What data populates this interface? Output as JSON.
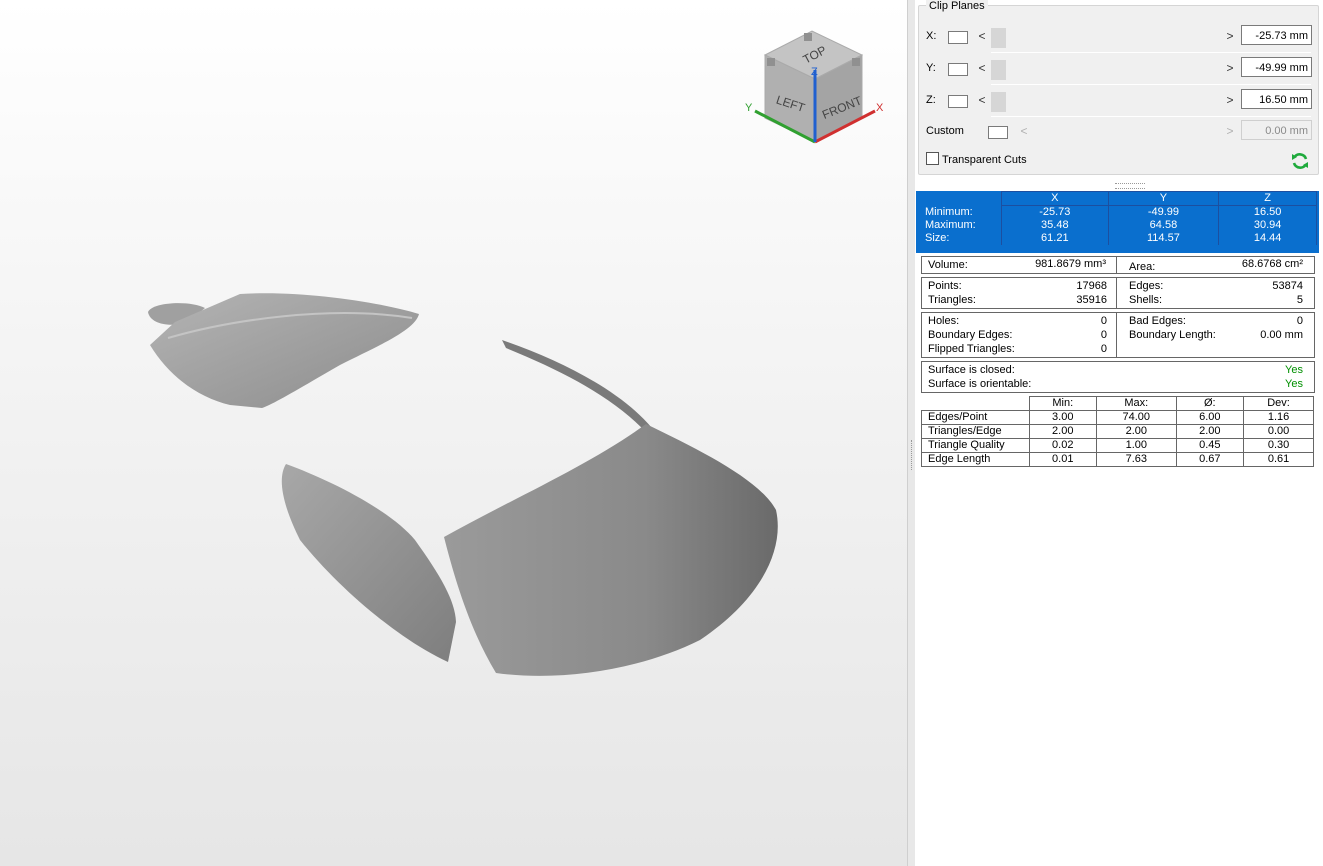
{
  "navcube": {
    "faces": {
      "top": "TOP",
      "left": "LEFT",
      "front": "FRONT"
    },
    "axes": {
      "x": "X",
      "y": "Y",
      "z": "Z"
    },
    "colors": {
      "x": "#d03030",
      "y": "#30a030",
      "z": "#2060d0"
    }
  },
  "clip_planes": {
    "title": "Clip Planes",
    "rows": [
      {
        "label": "X:",
        "value": "-25.73 mm"
      },
      {
        "label": "Y:",
        "value": "-49.99 mm"
      },
      {
        "label": "Z:",
        "value": "16.50 mm"
      },
      {
        "label": "Custom",
        "value": "0.00 mm"
      }
    ],
    "transparent_cuts_label": "Transparent Cuts",
    "arrow_left": "<",
    "arrow_right": ">"
  },
  "bounding_box": {
    "headers": [
      "X",
      "Y",
      "Z"
    ],
    "rows": [
      {
        "label": "Minimum:",
        "values": [
          "-25.73",
          "-49.99",
          "16.50"
        ]
      },
      {
        "label": "Maximum:",
        "values": [
          "35.48",
          "64.58",
          "30.94"
        ]
      },
      {
        "label": "Size:",
        "values": [
          "61.21",
          "114.57",
          "14.44"
        ]
      }
    ]
  },
  "volume": {
    "label": "Volume:",
    "value": "981.8679 mm³",
    "area_label": "Area:",
    "area_value": "68.6768 cm²"
  },
  "counts": {
    "points_label": "Points:",
    "points": "17968",
    "triangles_label": "Triangles:",
    "triangles": "35916",
    "edges_label": "Edges:",
    "edges": "53874",
    "shells_label": "Shells:",
    "shells": "5"
  },
  "errors": {
    "holes_label": "Holes:",
    "holes": "0",
    "boundary_edges_label": "Boundary Edges:",
    "boundary_edges": "0",
    "flipped_label": "Flipped Triangles:",
    "flipped": "0",
    "bad_edges_label": "Bad Edges:",
    "bad_edges": "0",
    "boundary_length_label": "Boundary Length:",
    "boundary_length": "0.00 mm"
  },
  "surface": {
    "closed_label": "Surface is closed:",
    "closed": "Yes",
    "orientable_label": "Surface is orientable:",
    "orientable": "Yes"
  },
  "stats": {
    "headers": [
      "Min:",
      "Max:",
      "Ø:",
      "Dev:"
    ],
    "rows": [
      {
        "label": "Edges/Point",
        "values": [
          "3.00",
          "74.00",
          "6.00",
          "1.16"
        ]
      },
      {
        "label": "Triangles/Edge",
        "values": [
          "2.00",
          "2.00",
          "2.00",
          "0.00"
        ]
      },
      {
        "label": "Triangle Quality",
        "values": [
          "0.02",
          "1.00",
          "0.45",
          "0.30"
        ]
      },
      {
        "label": "Edge Length",
        "values": [
          "0.01",
          "7.63",
          "0.67",
          "0.61"
        ]
      }
    ]
  }
}
